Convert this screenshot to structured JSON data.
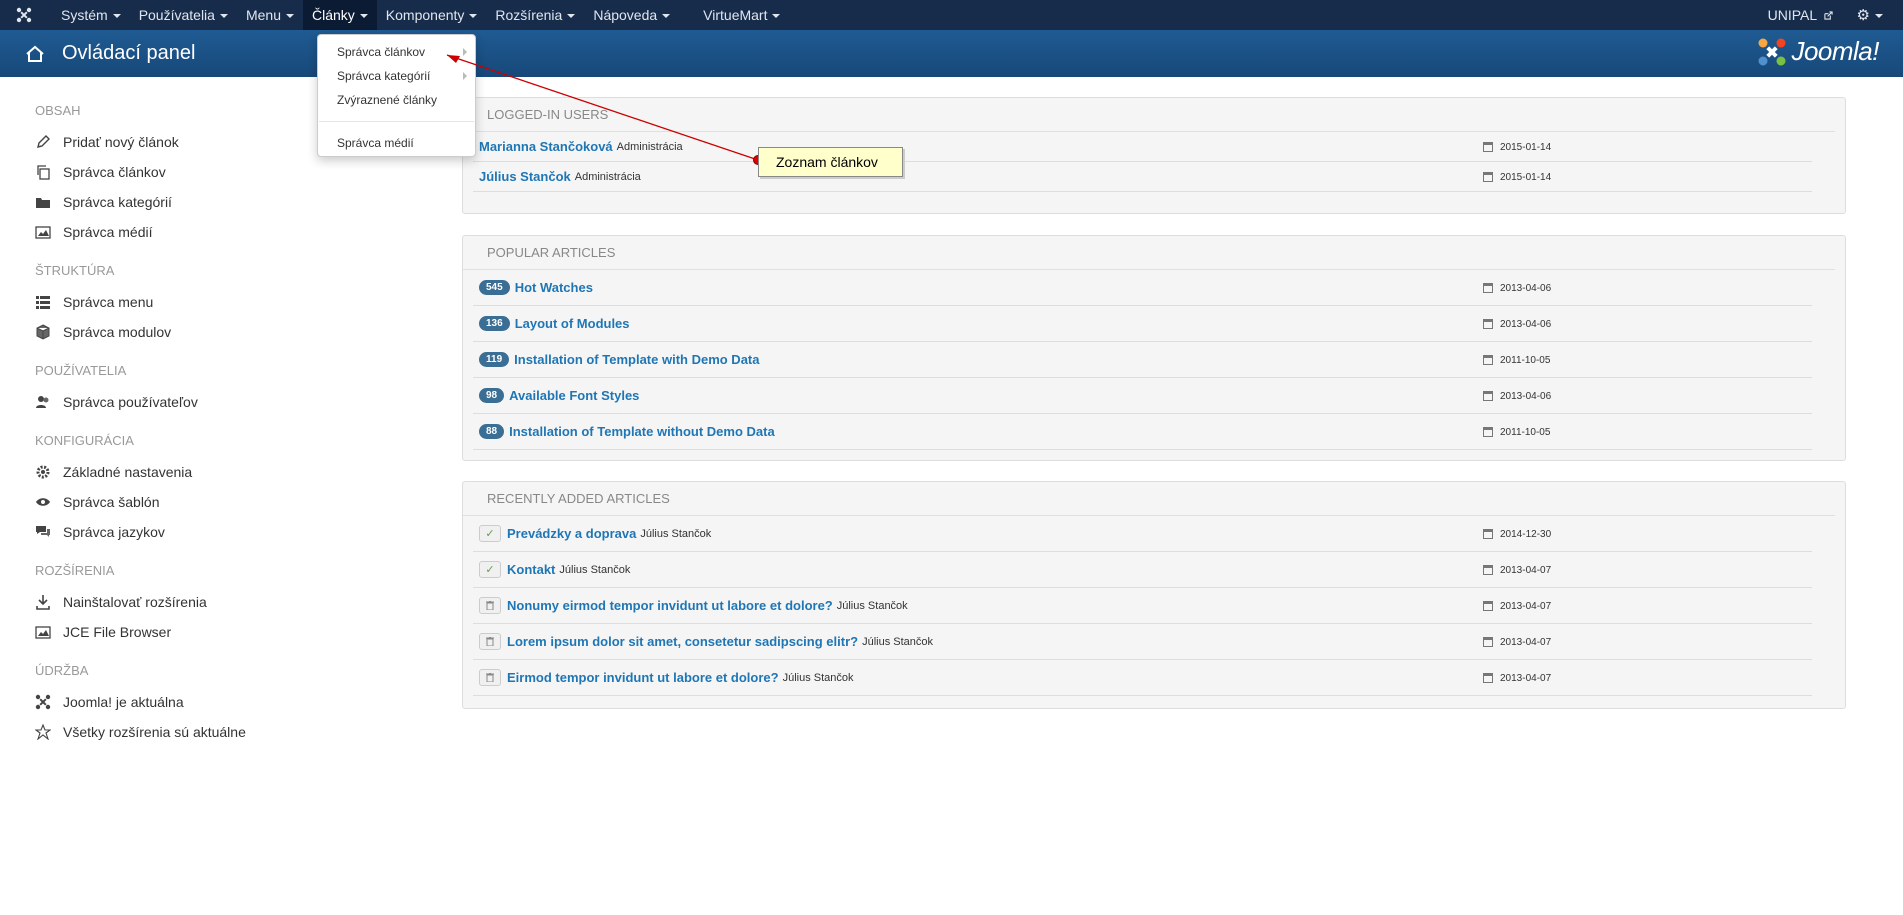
{
  "navbar": {
    "logo_icon": "joomla-icon",
    "items": [
      {
        "label": "Systém",
        "caret": true
      },
      {
        "label": "Používatelia",
        "caret": true
      },
      {
        "label": "Menu",
        "caret": true
      },
      {
        "label": "Články",
        "caret": true,
        "active": true
      },
      {
        "label": "Komponenty",
        "caret": true
      },
      {
        "label": "Rozšírenia",
        "caret": true
      },
      {
        "label": "Nápoveda",
        "caret": true
      },
      {
        "label": "VirtueMart",
        "caret": true
      }
    ],
    "user": "UNIPAL",
    "settings_icon": "gear-icon"
  },
  "subhead": {
    "title": "Ovládací panel",
    "brand": "Joomla!"
  },
  "dropdown": {
    "items": [
      "Správca článkov",
      "Správca kategórií",
      "Zvýraznené články"
    ],
    "after_divider": "Správca médií"
  },
  "sidebar": {
    "sections": [
      {
        "heading": "OBSAH",
        "items": [
          {
            "label": "Pridať nový článok",
            "icon": "pencil-icon"
          },
          {
            "label": "Správca článkov",
            "icon": "copy-icon"
          },
          {
            "label": "Správca kategórií",
            "icon": "folder-icon"
          },
          {
            "label": "Správca médií",
            "icon": "image-icon"
          }
        ]
      },
      {
        "heading": "ŠTRUKTÚRA",
        "items": [
          {
            "label": "Správca menu",
            "icon": "list-icon"
          },
          {
            "label": "Správca modulov",
            "icon": "cube-icon"
          }
        ]
      },
      {
        "heading": "POUŽÍVATELIA",
        "items": [
          {
            "label": "Správca používateľov",
            "icon": "users-icon"
          }
        ]
      },
      {
        "heading": "KONFIGURÁCIA",
        "items": [
          {
            "label": "Základné nastavenia",
            "icon": "cog-icon"
          },
          {
            "label": "Správca šablón",
            "icon": "eye-icon"
          },
          {
            "label": "Správca jazykov",
            "icon": "comments-icon"
          }
        ]
      },
      {
        "heading": "ROZŠÍRENIA",
        "items": [
          {
            "label": "Nainštalovať rozšírenia",
            "icon": "download-icon"
          },
          {
            "label": "JCE File Browser",
            "icon": "image-icon"
          }
        ]
      },
      {
        "heading": "ÚDRŽBA",
        "items": [
          {
            "label": "Joomla! je aktuálna",
            "icon": "joomla-icon"
          },
          {
            "label": "Všetky rozšírenia sú aktuálne",
            "icon": "star-icon"
          }
        ]
      }
    ]
  },
  "logged_in": {
    "heading": "LOGGED-IN USERS",
    "rows": [
      {
        "name": "Marianna Stančoková",
        "role": "Administrácia",
        "date": "2015-01-14"
      },
      {
        "name": "Július Stančok",
        "role": "Administrácia",
        "date": "2015-01-14"
      }
    ]
  },
  "popular": {
    "heading": "POPULAR ARTICLES",
    "rows": [
      {
        "hits": "545",
        "title": "Hot Watches",
        "date": "2013-04-06"
      },
      {
        "hits": "136",
        "title": "Layout of Modules",
        "date": "2013-04-06"
      },
      {
        "hits": "119",
        "title": "Installation of Template with Demo Data",
        "date": "2011-10-05"
      },
      {
        "hits": "98",
        "title": "Available Font Styles",
        "date": "2013-04-06"
      },
      {
        "hits": "88",
        "title": "Installation of Template without Demo Data",
        "date": "2011-10-05"
      }
    ]
  },
  "recent": {
    "heading": "RECENTLY ADDED ARTICLES",
    "rows": [
      {
        "status": "published",
        "title": "Prevádzky a doprava",
        "author": "Július Stančok",
        "date": "2014-12-30"
      },
      {
        "status": "published",
        "title": "Kontakt",
        "author": "Július Stančok",
        "date": "2013-04-07"
      },
      {
        "status": "trashed",
        "title": "Nonumy eirmod tempor invidunt ut labore et dolore?",
        "author": "Július Stančok",
        "date": "2013-04-07"
      },
      {
        "status": "trashed",
        "title": "Lorem ipsum dolor sit amet, consetetur sadipscing elitr?",
        "author": "Július Stančok",
        "date": "2013-04-07"
      },
      {
        "status": "trashed",
        "title": "Eirmod tempor invidunt ut labore et dolore?",
        "author": "Július Stančok",
        "date": "2013-04-07"
      }
    ]
  },
  "annotation": {
    "text": "Zoznam článkov",
    "color": "#cc0000"
  }
}
